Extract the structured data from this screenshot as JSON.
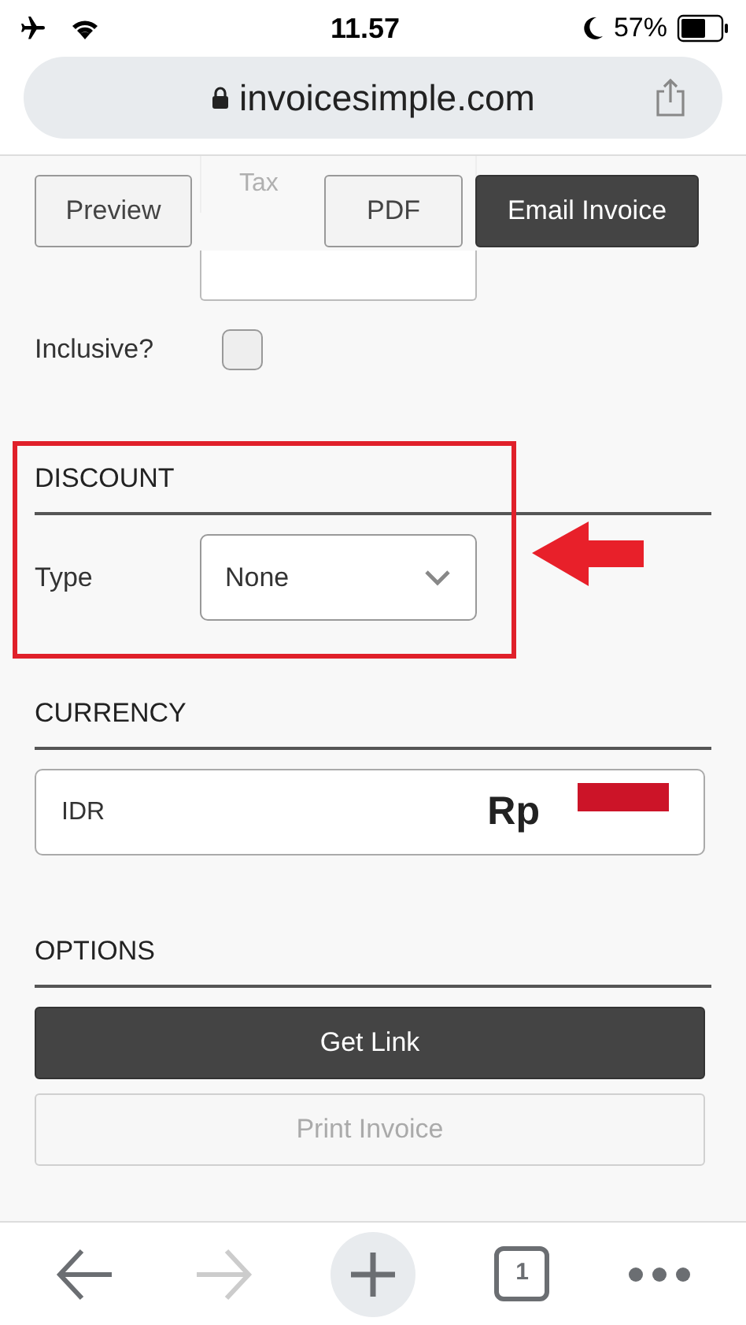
{
  "status_bar": {
    "time": "11.57",
    "battery": "57%"
  },
  "address_bar": {
    "url": "invoicesimple.com"
  },
  "toolbar": {
    "buttons": [
      {
        "label": "Preview",
        "kind": "secondary"
      },
      {
        "label": "PDF",
        "kind": "secondary"
      },
      {
        "label": "Email Invoice",
        "kind": "primary"
      }
    ]
  },
  "tax": {
    "label_placeholder": "Tax",
    "inclusive_label": "Inclusive?",
    "inclusive_checked": false
  },
  "discount": {
    "heading": "DISCOUNT",
    "type_label": "Type",
    "type_value": "None"
  },
  "currency": {
    "heading": "CURRENCY",
    "code": "IDR",
    "symbol": "Rp"
  },
  "options": {
    "heading": "OPTIONS",
    "buttons": [
      {
        "label": "Get Link",
        "kind": "primary",
        "disabled": false
      },
      {
        "label": "Print Invoice",
        "kind": "secondary",
        "disabled": true
      }
    ]
  },
  "bottom_nav": {
    "back_disabled": false,
    "forward_disabled": true,
    "tab_count": "1"
  }
}
